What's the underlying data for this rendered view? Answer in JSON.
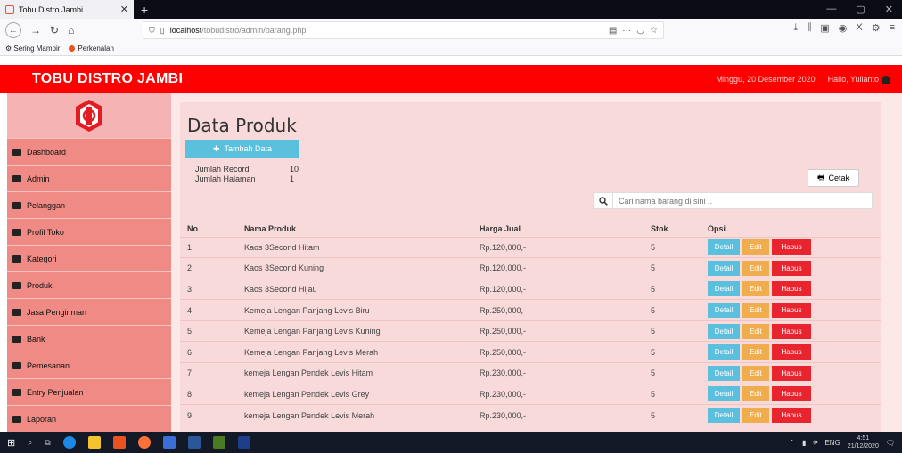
{
  "browser": {
    "tab_title": "Tobu Distro Jambi",
    "url_host": "localhost",
    "url_path": "/tobudistro/admin/barang.php",
    "bookmarks": [
      "Sering Mampir",
      "Perkenalan"
    ]
  },
  "header": {
    "brand": "TOBU DISTRO JAMBI",
    "date": "Minggu, 20 Desember 2020",
    "greeting": "Hallo, Yulianto"
  },
  "sidebar": {
    "items": [
      {
        "label": "Dashboard",
        "icon": "monitor-icon"
      },
      {
        "label": "Admin",
        "icon": "user-icon"
      },
      {
        "label": "Pelanggan",
        "icon": "users-icon"
      },
      {
        "label": "Profil Toko",
        "icon": "card-icon"
      },
      {
        "label": "Kategori",
        "icon": "list-icon"
      },
      {
        "label": "Produk",
        "icon": "box-icon"
      },
      {
        "label": "Jasa Pengiriman",
        "icon": "map-marker-icon"
      },
      {
        "label": "Bank",
        "icon": "dollar-icon"
      },
      {
        "label": "Pemesanan",
        "icon": "credit-card-icon"
      },
      {
        "label": "Entry Penjualan",
        "icon": "credit-card-icon"
      },
      {
        "label": "Laporan",
        "icon": "file-icon"
      }
    ]
  },
  "main": {
    "title": "Data Produk",
    "add_label": "Tambah Data",
    "record_label": "Jumlah Record",
    "record_value": "10",
    "page_label": "Jumlah Halaman",
    "page_value": "1",
    "print_label": "Cetak",
    "search_placeholder": "Cari nama barang di sini ..",
    "columns": [
      "No",
      "Nama Produk",
      "Harga Jual",
      "Stok",
      "Opsi"
    ],
    "action_labels": {
      "detail": "Detail",
      "edit": "Edit",
      "hapus": "Hapus"
    },
    "rows": [
      {
        "no": "1",
        "name": "Kaos 3Second Hitam",
        "price": "Rp.120,000,-",
        "stock": "5"
      },
      {
        "no": "2",
        "name": "Kaos 3Second Kuning",
        "price": "Rp.120,000,-",
        "stock": "5"
      },
      {
        "no": "3",
        "name": "Kaos 3Second Hijau",
        "price": "Rp.120,000,-",
        "stock": "5"
      },
      {
        "no": "4",
        "name": "Kemeja Lengan Panjang Levis Biru",
        "price": "Rp.250,000,-",
        "stock": "5"
      },
      {
        "no": "5",
        "name": "Kemeja Lengan Panjang Levis Kuning",
        "price": "Rp.250,000,-",
        "stock": "5"
      },
      {
        "no": "6",
        "name": "Kemeja Lengan Panjang Levis Merah",
        "price": "Rp.250,000,-",
        "stock": "5"
      },
      {
        "no": "7",
        "name": "kemeja Lengan Pendek Levis Hitam",
        "price": "Rp.230,000,-",
        "stock": "5"
      },
      {
        "no": "8",
        "name": "kemeja Lengan Pendek Levis Grey",
        "price": "Rp.230,000,-",
        "stock": "5"
      },
      {
        "no": "9",
        "name": "kemeja Lengan Pendek Levis Merah",
        "price": "Rp.230,000,-",
        "stock": "5"
      }
    ]
  },
  "taskbar": {
    "lang": "ENG",
    "time": "4:51",
    "date": "21/12/2020"
  },
  "colors": {
    "brand_red": "#ff0000",
    "sidebar_bg": "#f08a84",
    "detail_btn": "#5bc0de",
    "edit_btn": "#f0ad4e",
    "hapus_btn": "#e8242f"
  }
}
